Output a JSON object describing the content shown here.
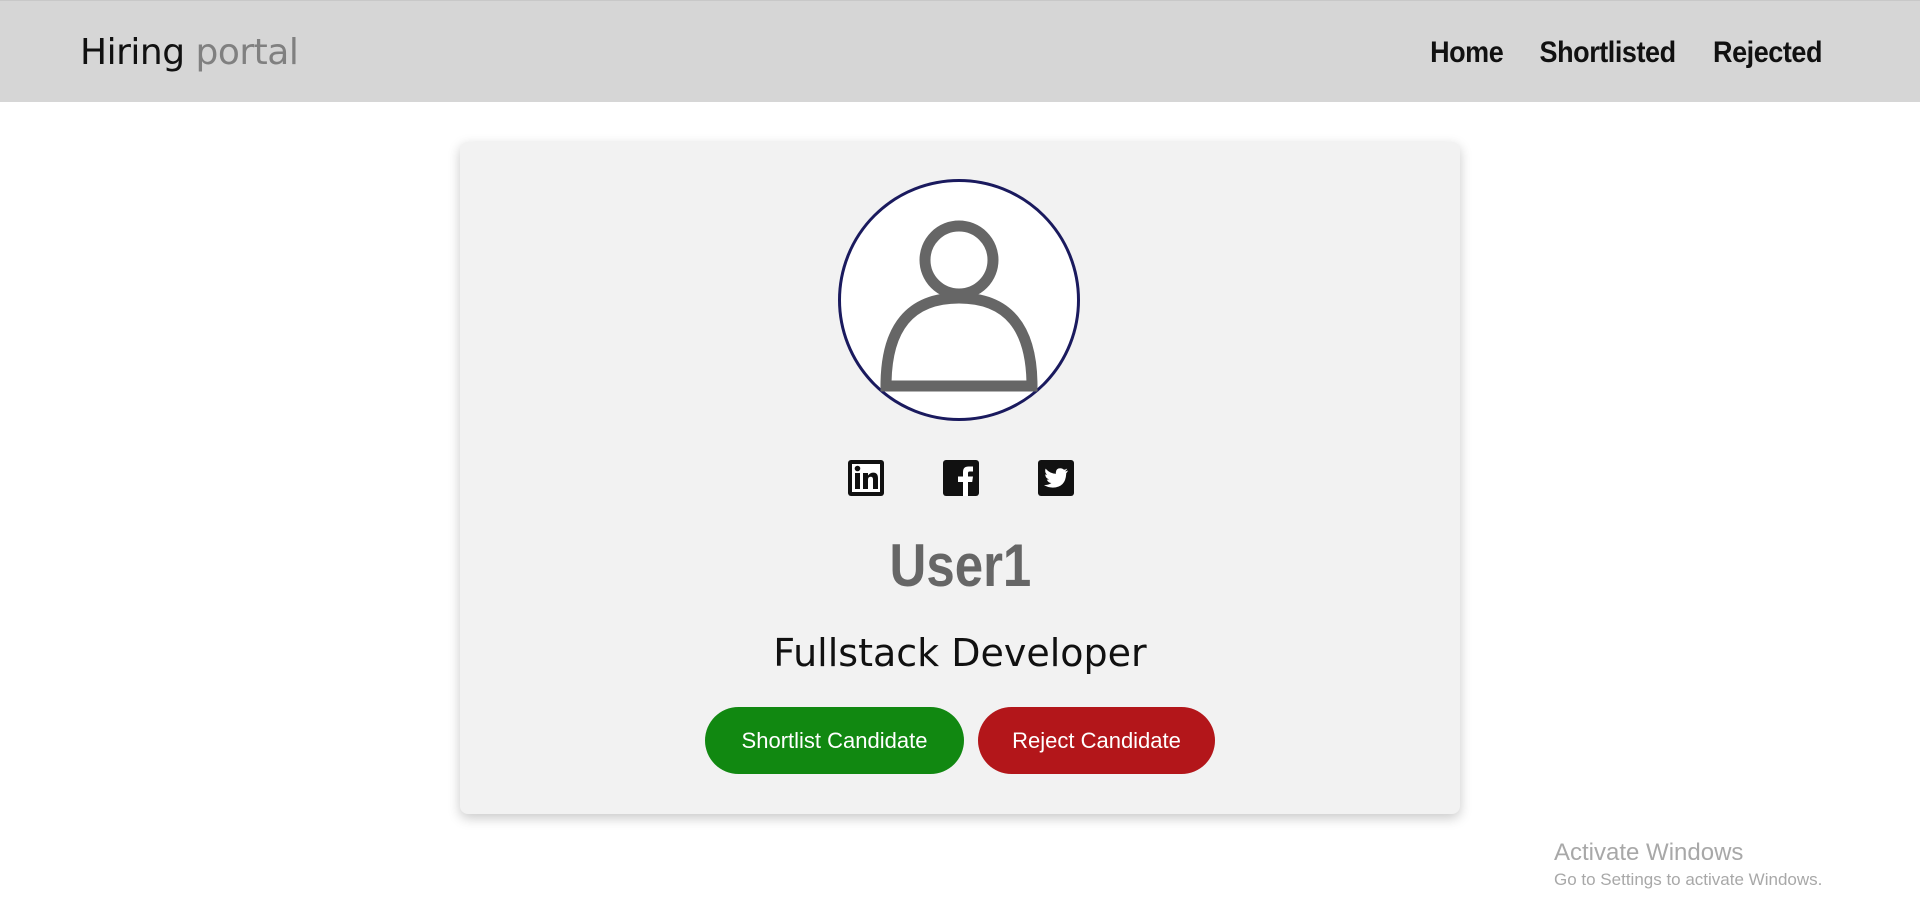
{
  "navbar": {
    "brand_main": "Hiring",
    "brand_sub": "portal",
    "links": [
      "Home",
      "Shortlisted",
      "Rejected"
    ],
    "background": "#d6d6d6"
  },
  "card": {
    "avatar_icon": "user-icon",
    "social_icons": [
      "linkedin-icon",
      "facebook-icon",
      "twitter-icon"
    ],
    "username": "User1",
    "role": "Fullstack Developer",
    "shortlist_label": "Shortlist Candidate",
    "reject_label": "Reject Candidate",
    "colors": {
      "shortlist": "#118811",
      "reject": "#b3161a",
      "username": "#666666",
      "avatar_border": "#1a1a5e"
    }
  },
  "watermark": {
    "title": "Activate Windows",
    "subtitle": "Go to Settings to activate Windows."
  }
}
